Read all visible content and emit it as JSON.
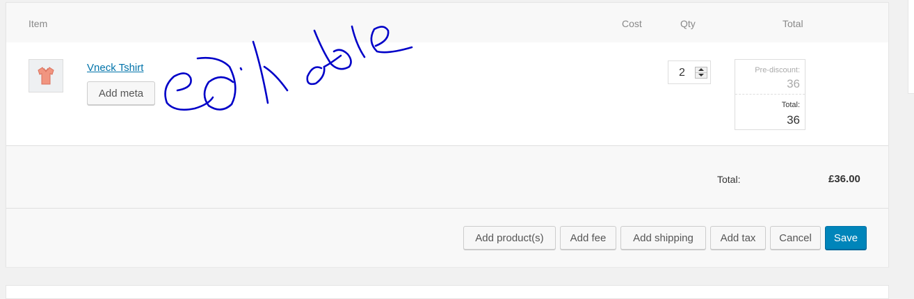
{
  "table": {
    "headers": {
      "item": "Item",
      "cost": "Cost",
      "qty": "Qty",
      "total": "Total"
    },
    "row": {
      "name": "Vneck Tshirt",
      "add_meta_label": "Add meta",
      "qty": "2",
      "pre_discount_label": "Pre-discount:",
      "pre_discount_value": "36",
      "total_label": "Total:",
      "total_value": "36",
      "thumbnail_icon": "tshirt-icon"
    }
  },
  "summary": {
    "total_label": "Total:",
    "total_value": "£36.00"
  },
  "actions": {
    "add_products": "Add product(s)",
    "add_fee": "Add fee",
    "add_shipping": "Add shipping",
    "add_tax": "Add tax",
    "cancel": "Cancel",
    "save": "Save"
  },
  "annotation": {
    "handwritten_text": "editable",
    "color": "#0000c8"
  },
  "colors": {
    "link": "#0073aa",
    "primary": "#0085ba"
  }
}
